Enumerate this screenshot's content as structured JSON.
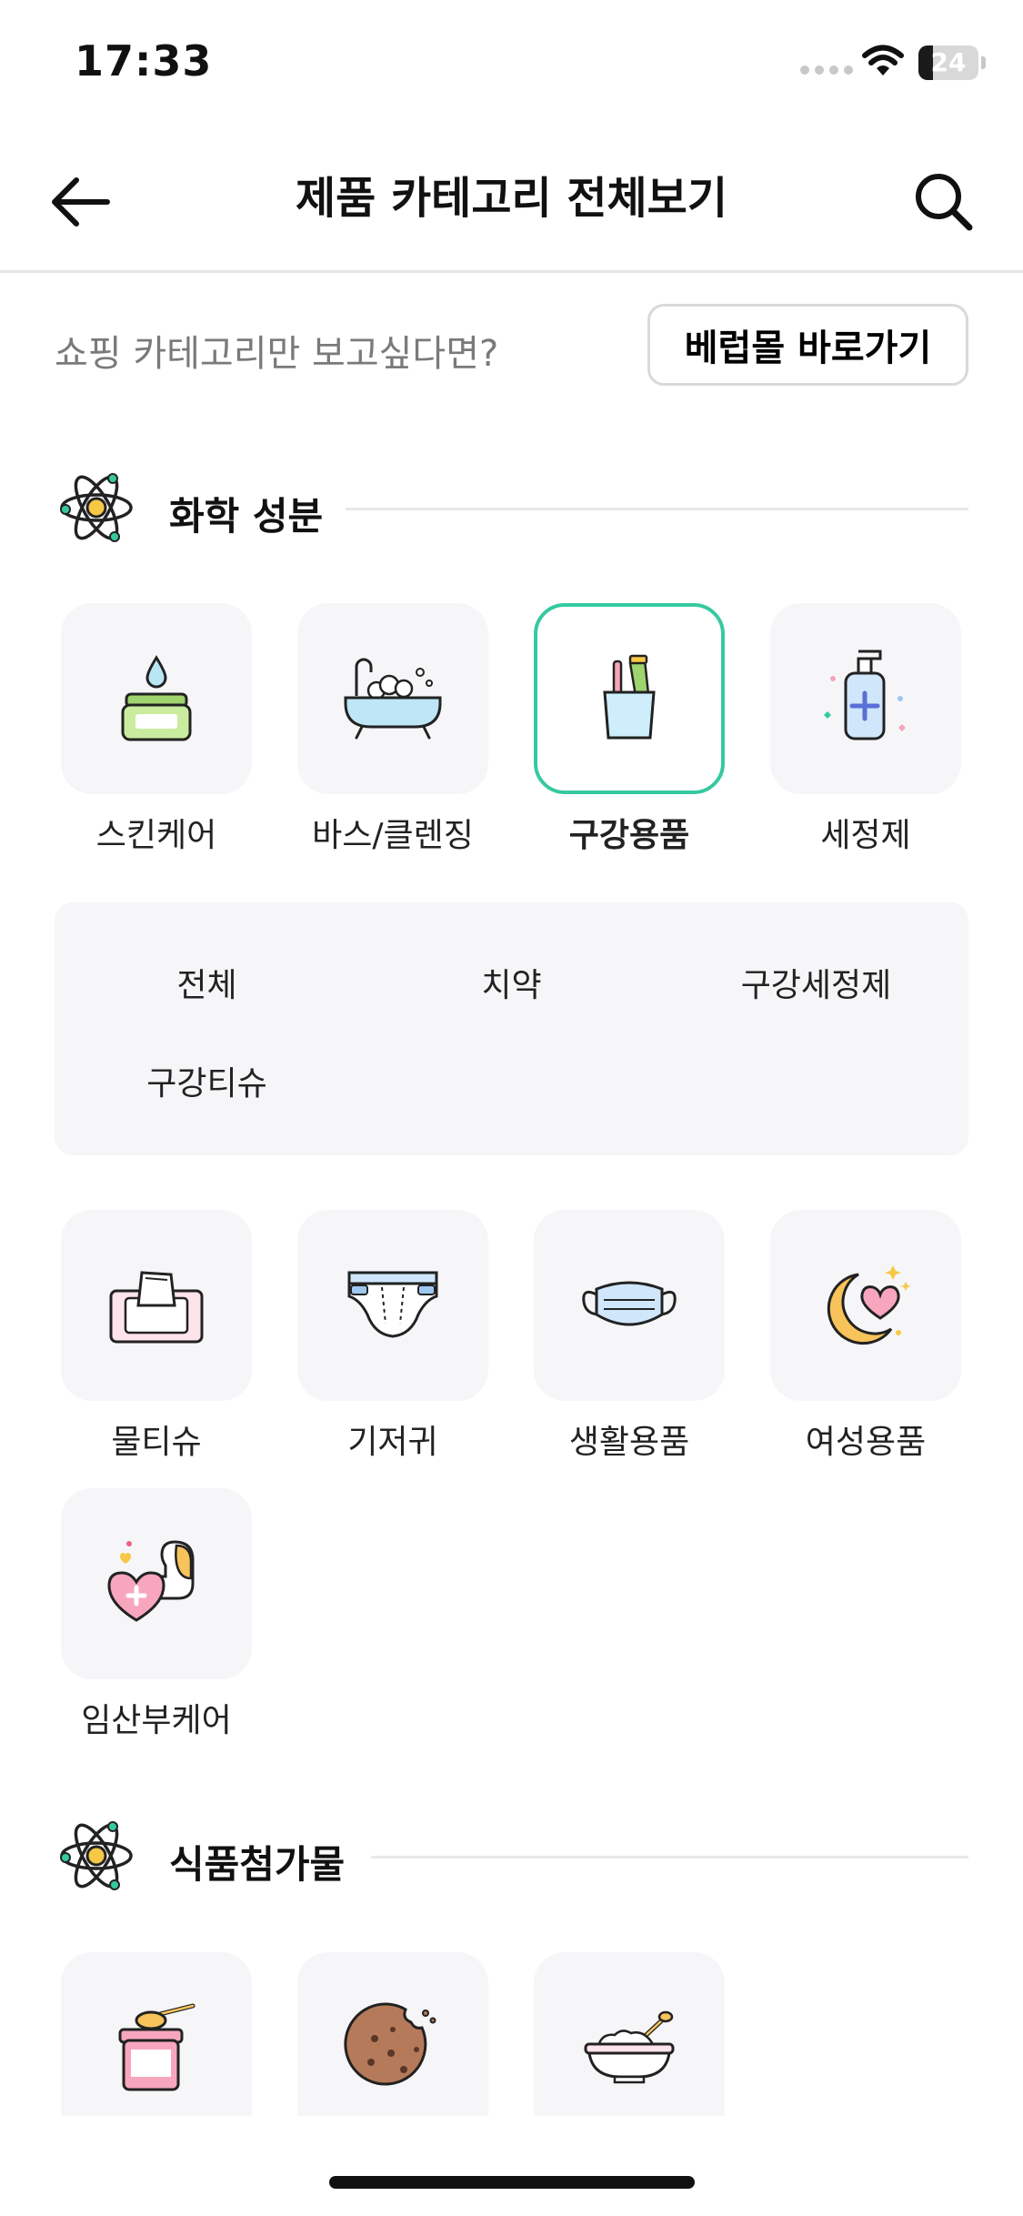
{
  "status_bar": {
    "time": "17:33",
    "battery_percent": "24",
    "icons": [
      "cellular-signal-icon",
      "wifi-icon",
      "battery-icon"
    ]
  },
  "header": {
    "title": "제품 카테고리 전체보기",
    "back_icon": "arrow-left-icon",
    "search_icon": "search-icon"
  },
  "shopping": {
    "prompt": "쇼핑 카테고리만 보고싶다면?",
    "button_label": "베럽몰 바로가기"
  },
  "sections": [
    {
      "title": "화학 성분",
      "icon": "atom-icon",
      "categories": [
        {
          "label": "스킨케어",
          "icon": "cream-jar-icon",
          "selected": false
        },
        {
          "label": "바스/클렌징",
          "icon": "bathtub-icon",
          "selected": false
        },
        {
          "label": "구강용품",
          "icon": "toothbrush-cup-icon",
          "selected": true
        },
        {
          "label": "세정제",
          "icon": "pump-bottle-icon",
          "selected": false
        },
        {
          "label": "물티슈",
          "icon": "wet-wipes-icon",
          "selected": false
        },
        {
          "label": "기저귀",
          "icon": "diaper-icon",
          "selected": false
        },
        {
          "label": "생활용품",
          "icon": "face-mask-icon",
          "selected": false
        },
        {
          "label": "여성용품",
          "icon": "moon-heart-icon",
          "selected": false
        },
        {
          "label": "임산부케어",
          "icon": "heart-care-icon",
          "selected": false
        }
      ],
      "subcategories": [
        "전체",
        "치약",
        "구강세정제",
        "구강티슈"
      ]
    },
    {
      "title": "식품첨가물",
      "icon": "atom-icon",
      "categories": [
        {
          "label": "",
          "icon": "formula-jar-icon",
          "selected": false
        },
        {
          "label": "",
          "icon": "cookie-icon",
          "selected": false
        },
        {
          "label": "",
          "icon": "rice-bowl-icon",
          "selected": false
        }
      ]
    }
  ],
  "colors": {
    "accent": "#36c9a0",
    "tile_background": "#f6f6f8",
    "muted_text": "#7a7a7a",
    "divider": "#e6e6e6"
  }
}
